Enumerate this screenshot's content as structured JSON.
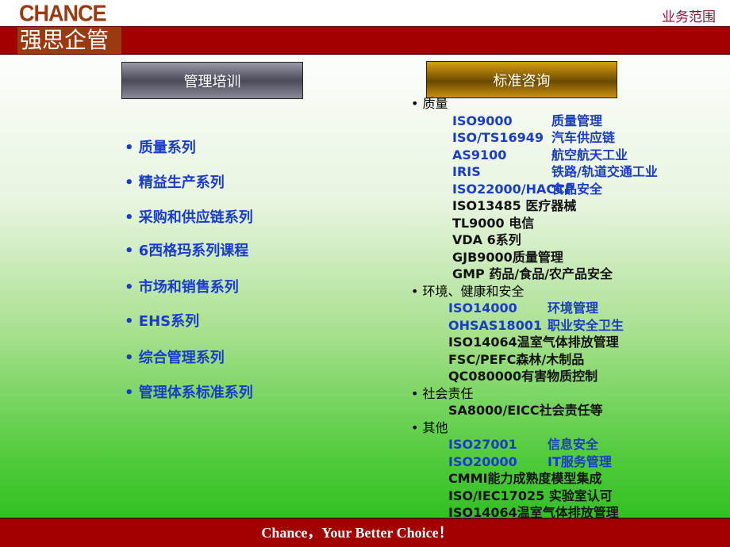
{
  "header": {
    "logo_en": "CHANCE",
    "logo_cn": "强思企管",
    "section": "业务范围"
  },
  "buttons": {
    "training": "管理培训",
    "consulting": "标准咨询"
  },
  "training_list": [
    "• 质量系列",
    "• 精益生产系列",
    "• 采购和供应链系列",
    "• 6西格玛系列课程",
    "• 市场和销售系列",
    "• EHS系列",
    "• 综合管理系列",
    "• 管理体系标准系列"
  ],
  "consulting": [
    {
      "category": "• 质量",
      "indent": 52,
      "items": [
        {
          "code": "ISO9000",
          "desc": "质量管理",
          "blue": true
        },
        {
          "code": "ISO/TS16949",
          "desc": "汽车供应链",
          "blue": true
        },
        {
          "code": "AS9100",
          "desc": "航空航天工业",
          "blue": true
        },
        {
          "code": "IRIS",
          "desc": "铁路/轨道交通工业",
          "blue": true
        },
        {
          "code": "ISO22000/HACCP",
          "desc": "食品安全",
          "blue": true
        },
        {
          "text": "ISO13485 医疗器械"
        },
        {
          "text": "TL9000 电信"
        },
        {
          "text": "VDA 6系列"
        },
        {
          "text": "GJB9000质量管理"
        },
        {
          "text": "GMP 药品/食品/农产品安全"
        }
      ]
    },
    {
      "category": "• 环境、健康和安全",
      "indent": 47,
      "items": [
        {
          "code": "ISO14000",
          "desc": "环境管理",
          "blue": true
        },
        {
          "code": "OHSAS18001",
          "desc": "职业安全卫生",
          "blue": true
        },
        {
          "text": "ISO14064温室气体排放管理"
        },
        {
          "text": "FSC/PEFC森林/木制品"
        },
        {
          "text": "QC080000有害物质控制"
        }
      ]
    },
    {
      "category": "• 社会责任",
      "indent": 47,
      "items": [
        {
          "text": "SA8000/EICC社会责任等"
        }
      ]
    },
    {
      "category": "• 其他",
      "indent": 47,
      "items": [
        {
          "code": "ISO27001",
          "desc": "信息安全",
          "blue": true
        },
        {
          "code": "ISO20000",
          "desc": "IT服务管理",
          "blue": true
        },
        {
          "text": "CMMI能力成熟度模型集成"
        },
        {
          "text": "ISO/IEC17025 实验室认可"
        },
        {
          "text": "ISO14064温室气体排放管理"
        }
      ]
    }
  ],
  "footer": "Chance，Your Better Choice！",
  "colors": {
    "band": "#a30000",
    "logo": "#9b3a10",
    "blue_text": "#1a3cc8"
  }
}
